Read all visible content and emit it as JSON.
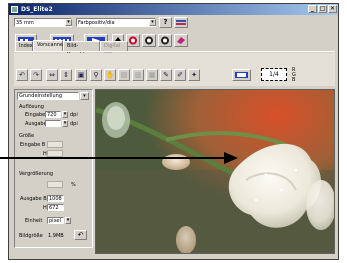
{
  "window": {
    "title": "DS_Elite2",
    "controls": {
      "minimize": "_",
      "maximize": "□",
      "close": "✕"
    }
  },
  "toolbar": {
    "film_select": "35 mm",
    "film_type_select": "Farbpositiv/dia",
    "help_icon": "?",
    "scan_buttons": [
      "Pre",
      "Scan",
      "Scan"
    ]
  },
  "tabs": [
    {
      "label": "Index",
      "active": false
    },
    {
      "label": "Vorscannen",
      "active": true
    },
    {
      "label": "Bild-Korrektur",
      "active": false
    },
    {
      "label": "Digital ICE",
      "active": false
    }
  ],
  "frame_indicator": "1/4",
  "frame_letters": [
    "R",
    "G",
    "B"
  ],
  "side_panel": {
    "preset_select": "Grundeinstellung",
    "resolution_heading": "Auflösung",
    "input_label": "Eingabe",
    "input_value": "720",
    "input_unit": "dpi",
    "output_label": "Ausgabe",
    "output_value": "",
    "output_unit": "dpi",
    "size_heading": "Größe",
    "input_width_label": "Eingabe B",
    "input_height_label": "H",
    "magnification_heading": "Vergrößerung",
    "magnification_unit": "%",
    "output_width_label": "Ausgabe B",
    "output_width_value": "1008",
    "output_height_label": "H",
    "output_height_value": "672",
    "unit_label": "Einheit",
    "unit_value": "pixel",
    "image_size_label": "Bildgröße",
    "image_size_value": "1.9MB"
  },
  "colors": {
    "window_face": "#d4d0c8",
    "title_start": "#0a246a",
    "title_end": "#a6caf0",
    "lock_icon": "#c8002a"
  }
}
